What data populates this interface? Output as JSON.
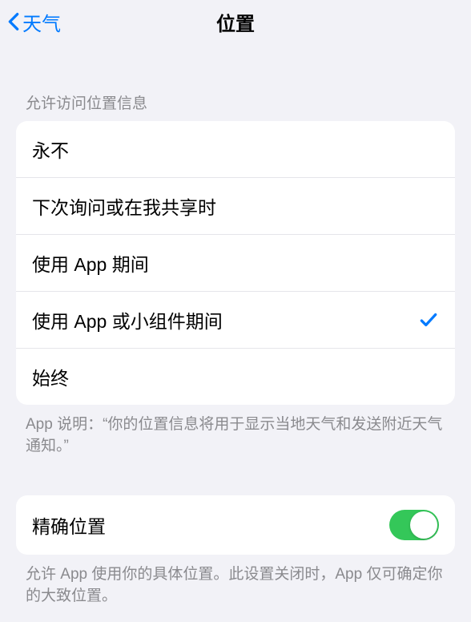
{
  "nav": {
    "back_label": "天气",
    "title": "位置"
  },
  "section1": {
    "header": "允许访问位置信息",
    "options": {
      "o0": "永不",
      "o1": "下次询问或在我共享时",
      "o2": "使用 App 期间",
      "o3": "使用 App 或小组件期间",
      "o4": "始终"
    },
    "selected_index": 3,
    "footer": "App 说明：“你的位置信息将用于显示当地天气和发送附近天气通知。”"
  },
  "section2": {
    "label": "精确位置",
    "toggle_on": true,
    "footer": "允许 App 使用你的具体位置。此设置关闭时，App 仅可确定你的大致位置。"
  }
}
